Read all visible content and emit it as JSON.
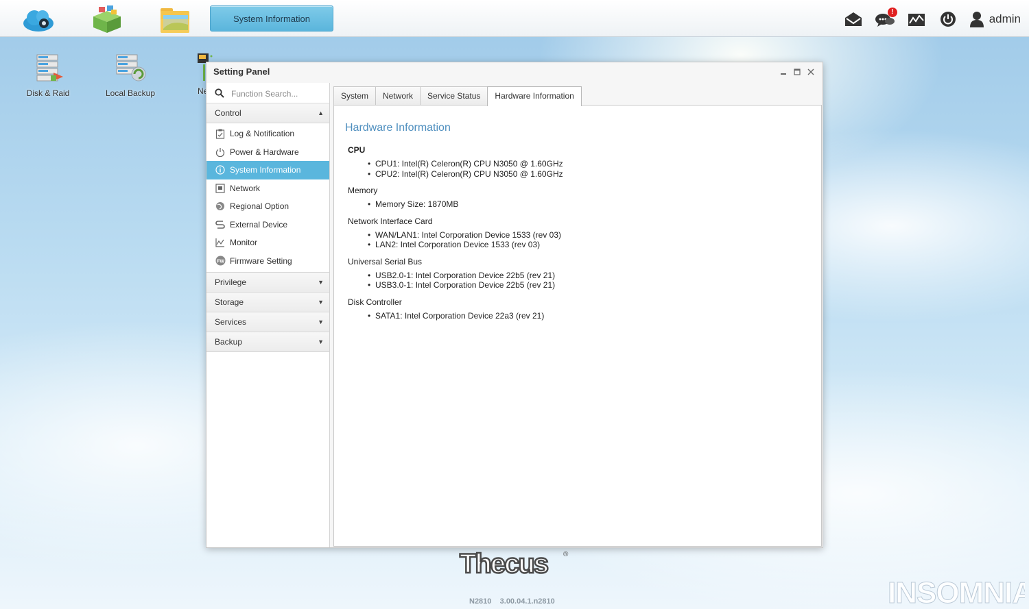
{
  "taskbar": {
    "apps": [
      "cloud-app",
      "app-center",
      "file-station"
    ],
    "active_task_label": "System Information",
    "user_label": "admin",
    "notification_badge": "!"
  },
  "desktop": {
    "icons": [
      {
        "label": "Disk & Raid"
      },
      {
        "label": "Local Backup"
      },
      {
        "label": "Ne"
      }
    ]
  },
  "window": {
    "title": "Setting Panel",
    "search_placeholder": "Function Search...",
    "sidebar": {
      "control_label": "Control",
      "items": [
        {
          "label": "Log & Notification",
          "icon": "clipboard-icon"
        },
        {
          "label": "Power & Hardware",
          "icon": "power-icon"
        },
        {
          "label": "System Information",
          "icon": "info-icon",
          "active": true
        },
        {
          "label": "Network",
          "icon": "network-icon"
        },
        {
          "label": "Regional Option",
          "icon": "globe-icon"
        },
        {
          "label": "External Device",
          "icon": "usb-icon"
        },
        {
          "label": "Monitor",
          "icon": "chart-icon"
        },
        {
          "label": "Firmware Setting",
          "icon": "firmware-icon"
        }
      ],
      "sections": [
        {
          "label": "Privilege"
        },
        {
          "label": "Storage"
        },
        {
          "label": "Services"
        },
        {
          "label": "Backup"
        }
      ]
    },
    "tabs": [
      {
        "label": "System"
      },
      {
        "label": "Network"
      },
      {
        "label": "Service Status"
      },
      {
        "label": "Hardware Information",
        "active": true
      }
    ],
    "content": {
      "heading": "Hardware Information",
      "groups": [
        {
          "title": "CPU",
          "items": [
            "CPU1: Intel(R) Celeron(R) CPU N3050 @ 1.60GHz",
            "CPU2: Intel(R) Celeron(R) CPU N3050 @ 1.60GHz"
          ]
        },
        {
          "title": "Memory",
          "items": [
            "Memory Size: 1870MB"
          ]
        },
        {
          "title": "Network Interface Card",
          "items": [
            "WAN/LAN1: Intel Corporation Device 1533 (rev 03)",
            "LAN2: Intel Corporation Device 1533 (rev 03)"
          ]
        },
        {
          "title": "Universal Serial Bus",
          "items": [
            "USB2.0-1: Intel Corporation Device 22b5 (rev 21)",
            "USB3.0-1: Intel Corporation Device 22b5 (rev 21)"
          ]
        },
        {
          "title": "Disk Controller",
          "items": [
            "SATA1: Intel Corporation Device 22a3 (rev 21)"
          ]
        }
      ]
    }
  },
  "footer": {
    "brand": "Thecus",
    "version": "N2810    3.00.04.1.n2810",
    "watermark": "INSOMNIA"
  },
  "colors": {
    "accent": "#5ab6dd",
    "heading": "#4f8fbf"
  }
}
